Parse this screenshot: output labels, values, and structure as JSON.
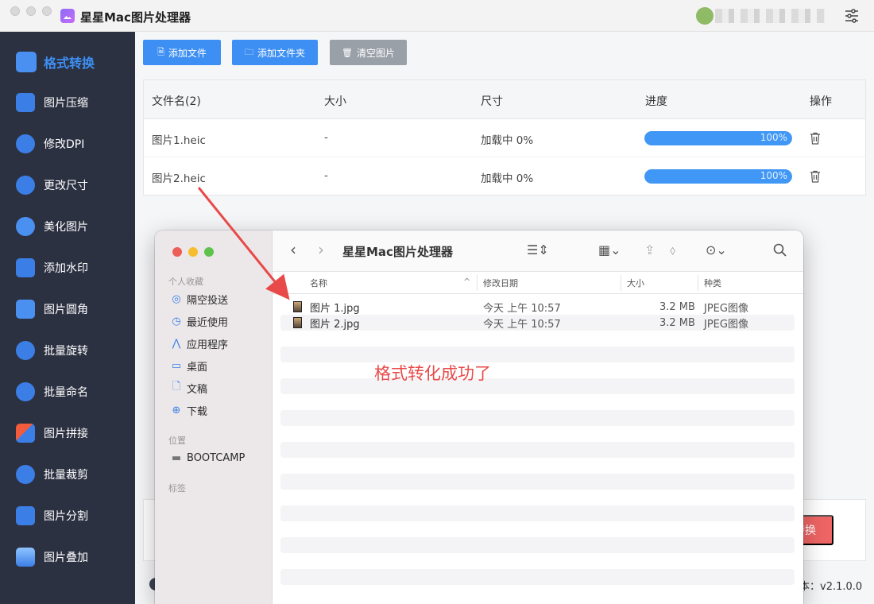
{
  "app": {
    "title": "星星Mac图片处理器"
  },
  "sidebar": {
    "items": [
      {
        "label": "格式转换",
        "icon": "image-convert-icon",
        "active": true
      },
      {
        "label": "图片压缩",
        "icon": "compress-icon"
      },
      {
        "label": "修改DPI",
        "icon": "dpi-icon"
      },
      {
        "label": "更改尺寸",
        "icon": "resize-icon"
      },
      {
        "label": "美化图片",
        "icon": "beautify-icon"
      },
      {
        "label": "添加水印",
        "icon": "watermark-icon"
      },
      {
        "label": "图片圆角",
        "icon": "round-corner-icon"
      },
      {
        "label": "批量旋转",
        "icon": "rotate-icon"
      },
      {
        "label": "批量命名",
        "icon": "rename-icon"
      },
      {
        "label": "图片拼接",
        "icon": "stitch-icon"
      },
      {
        "label": "批量裁剪",
        "icon": "crop-icon"
      },
      {
        "label": "图片分割",
        "icon": "split-icon"
      },
      {
        "label": "图片叠加",
        "icon": "layers-icon"
      }
    ]
  },
  "toolbar": {
    "add_file": "添加文件",
    "add_folder": "添加文件夹",
    "clear": "清空图片"
  },
  "table": {
    "headers": {
      "name": "文件名(2)",
      "size": "大小",
      "dimensions": "尺寸",
      "progress": "进度",
      "actions": "操作"
    },
    "rows": [
      {
        "name": "图片1.heic",
        "size": "-",
        "dimensions": "加载中 0%",
        "progress": 100,
        "progress_text": "100%"
      },
      {
        "name": "图片2.heic",
        "size": "-",
        "dimensions": "加载中 0%",
        "progress": 100,
        "progress_text": "100%"
      }
    ]
  },
  "bottom": {
    "convert_label": "转换",
    "version": "本：v2.1.0.0"
  },
  "annotation": {
    "text": "格式转化成功了",
    "color": "#e84a4a"
  },
  "finder": {
    "title": "星星Mac图片处理器",
    "sidebar": {
      "favorites_label": "个人收藏",
      "favorites": [
        {
          "label": "隔空投送",
          "icon": "airdrop-icon"
        },
        {
          "label": "最近使用",
          "icon": "clock-icon"
        },
        {
          "label": "应用程序",
          "icon": "applications-icon"
        },
        {
          "label": "桌面",
          "icon": "desktop-icon"
        },
        {
          "label": "文稿",
          "icon": "document-icon"
        },
        {
          "label": "下载",
          "icon": "download-icon"
        }
      ],
      "locations_label": "位置",
      "locations": [
        {
          "label": "BOOTCAMP",
          "icon": "disk-icon"
        }
      ],
      "tags_label": "标签"
    },
    "columns": {
      "name": "名称",
      "date": "修改日期",
      "size": "大小",
      "kind": "种类"
    },
    "files": [
      {
        "name": "图片 1.jpg",
        "date": "今天 上午 10:57",
        "size": "3.2 MB",
        "kind": "JPEG图像"
      },
      {
        "name": "图片 2.jpg",
        "date": "今天 上午 10:57",
        "size": "3.2 MB",
        "kind": "JPEG图像"
      }
    ]
  },
  "colors": {
    "accent": "#3d8ff3",
    "sidebar_bg": "#2c3142",
    "danger": "#ef6565"
  }
}
